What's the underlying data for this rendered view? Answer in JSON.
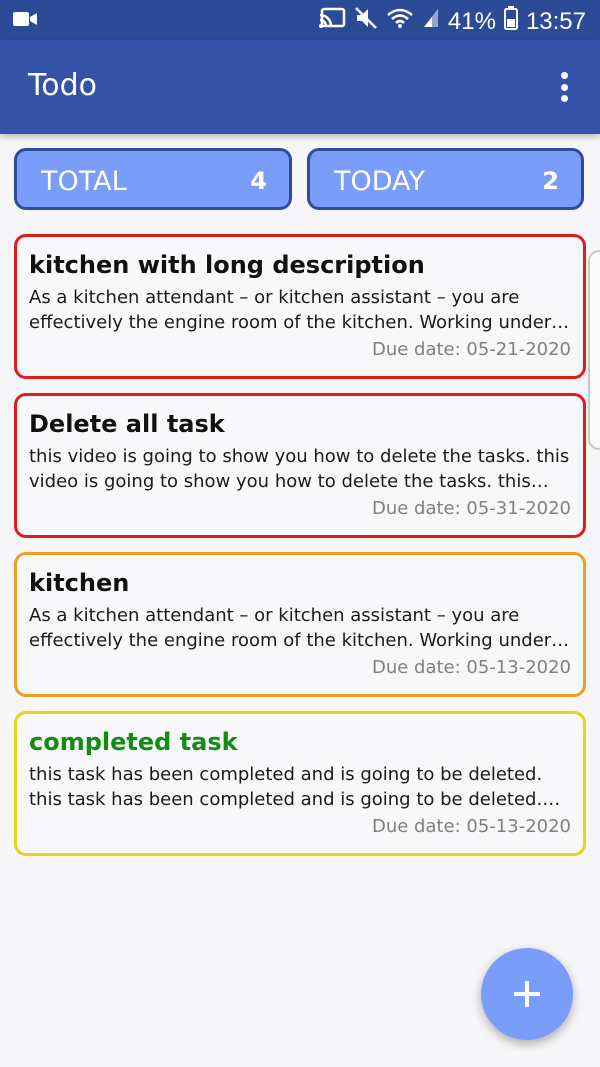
{
  "status_bar": {
    "battery": "41%",
    "time": "13:57",
    "icons": [
      "video-camera-icon",
      "cast-icon",
      "mute-icon",
      "wifi-icon",
      "signal-icon",
      "battery-icon"
    ]
  },
  "app_bar": {
    "title": "Todo",
    "menu_icon": "more-vert-icon"
  },
  "counters": {
    "total": {
      "label": "TOTAL",
      "value": "4"
    },
    "today": {
      "label": "TODAY",
      "value": "2"
    }
  },
  "tasks": [
    {
      "title": "kitchen with long description",
      "description": "As a kitchen attendant – or kitchen assistant – you are effectively the engine room of the kitchen. Working under t...",
      "due": "Due date: 05-21-2020",
      "border_color": "#e01b1b",
      "title_color": "#111111"
    },
    {
      "title": "Delete all task",
      "description": "this video is going to show you how to delete the tasks. this video is going to show you how to delete the tasks. this video...",
      "due": "Due date: 05-31-2020",
      "border_color": "#e01b1b",
      "title_color": "#111111"
    },
    {
      "title": "kitchen",
      "description": "As a kitchen attendant – or kitchen assistant – you are effectively the engine room of the kitchen. Working under t...",
      "due": "Due date: 05-13-2020",
      "border_color": "#f0a020",
      "title_color": "#111111"
    },
    {
      "title": "completed task",
      "description": "this task has been completed and is going to be deleted. this task has been completed and is going to be deleted. this tas...",
      "due": "Due date: 05-13-2020",
      "border_color": "#e0d81c",
      "title_color": "#148c14"
    }
  ],
  "fab": {
    "icon": "plus-icon"
  },
  "colors": {
    "primary": "#3453a8",
    "status_bar": "#2c4b97",
    "accent": "#7a9dfa"
  }
}
